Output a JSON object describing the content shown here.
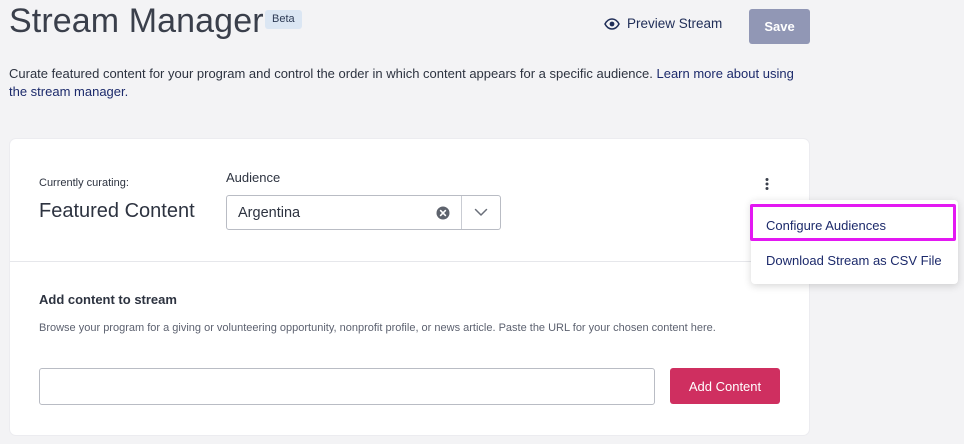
{
  "header": {
    "title": "Stream Manager",
    "badge": "Beta",
    "preview_label": "Preview Stream",
    "preview_icon": "eye-icon",
    "save_label": "Save"
  },
  "description": {
    "text": "Curate featured content for your program and control the order in which content appears for a specific audience. ",
    "link_text": "Learn more about using the stream manager."
  },
  "curation": {
    "label": "Currently curating:",
    "value": "Featured Content"
  },
  "audience": {
    "label": "Audience",
    "value": "Argentina",
    "clear_icon": "clear-circle-icon",
    "dropdown_icon": "chevron-down-icon"
  },
  "menu": {
    "icon": "kebab-menu-icon",
    "items": [
      "Configure Audiences",
      "Download Stream as CSV File"
    ],
    "highlight_color": "#e318f2"
  },
  "add_content": {
    "title": "Add content to stream",
    "help": "Browse your program for a giving or volunteering opportunity, nonprofit profile, or news article. Paste the URL for your chosen content here.",
    "input_value": "",
    "button_label": "Add Content"
  },
  "colors": {
    "save_button": "#9197b5",
    "add_button": "#cf2f60",
    "link": "#1c2a6b",
    "badge_bg": "#dbe6f3"
  }
}
